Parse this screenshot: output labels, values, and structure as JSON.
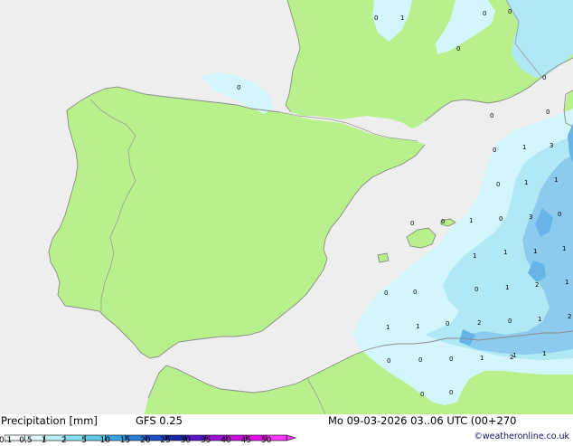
{
  "header": {
    "title": "Precipitation [mm]",
    "model": "GFS 0.25",
    "valid_time": "Mo 09-03-2026 03..06 UTC (00+270"
  },
  "credit": "©weatheronline.co.uk",
  "legend": {
    "ticks": [
      "0.1",
      "0.5",
      "1",
      "2",
      "5",
      "10",
      "15",
      "20",
      "25",
      "30",
      "35",
      "40",
      "45",
      "50"
    ],
    "colors": [
      "#f5fdfd",
      "#e0f8fb",
      "#b8eef5",
      "#8adfee",
      "#5fcbe6",
      "#3aa6e0",
      "#2e7ed8",
      "#1f4ec8",
      "#1a28a8",
      "#5a14c8",
      "#9a12d8",
      "#c80ed8",
      "#e80ce8",
      "#f43af4"
    ]
  },
  "map": {
    "colors": {
      "sea": "#eeeeee",
      "land": "#b8f08c",
      "coast": "#8a8a8a",
      "border": "#9a9a9a",
      "precip_light": "#d2f6fb",
      "precip_mid": "#b0e8f6",
      "precip_heavy": "#8ccbee",
      "precip_core": "#66b4e8"
    },
    "values": [
      {
        "t": "0"
      },
      {
        "t": "1"
      },
      {
        "t": "0"
      },
      {
        "t": "0"
      },
      {
        "t": "0"
      },
      {
        "t": "0"
      },
      {
        "t": "0"
      },
      {
        "t": "0"
      },
      {
        "t": "0"
      },
      {
        "t": "1"
      },
      {
        "t": "3"
      },
      {
        "t": "0"
      },
      {
        "t": "1"
      },
      {
        "t": "1"
      },
      {
        "t": "0"
      },
      {
        "t": "3"
      },
      {
        "t": "0"
      },
      {
        "t": "0"
      },
      {
        "t": "0"
      },
      {
        "t": "1"
      },
      {
        "t": "0"
      },
      {
        "t": "1"
      },
      {
        "t": "1"
      },
      {
        "t": "1"
      },
      {
        "t": "1"
      },
      {
        "t": "0"
      },
      {
        "t": "0"
      },
      {
        "t": "1"
      },
      {
        "t": "2"
      },
      {
        "t": "1"
      },
      {
        "t": "0"
      },
      {
        "t": "0"
      },
      {
        "t": "1"
      },
      {
        "t": "1"
      },
      {
        "t": "0"
      },
      {
        "t": "2"
      },
      {
        "t": "1"
      },
      {
        "t": "2"
      },
      {
        "t": "2"
      },
      {
        "t": "0"
      },
      {
        "t": "0"
      },
      {
        "t": "0"
      },
      {
        "t": "1"
      },
      {
        "t": "1"
      },
      {
        "t": "1"
      },
      {
        "t": "0"
      },
      {
        "t": "0"
      }
    ]
  }
}
